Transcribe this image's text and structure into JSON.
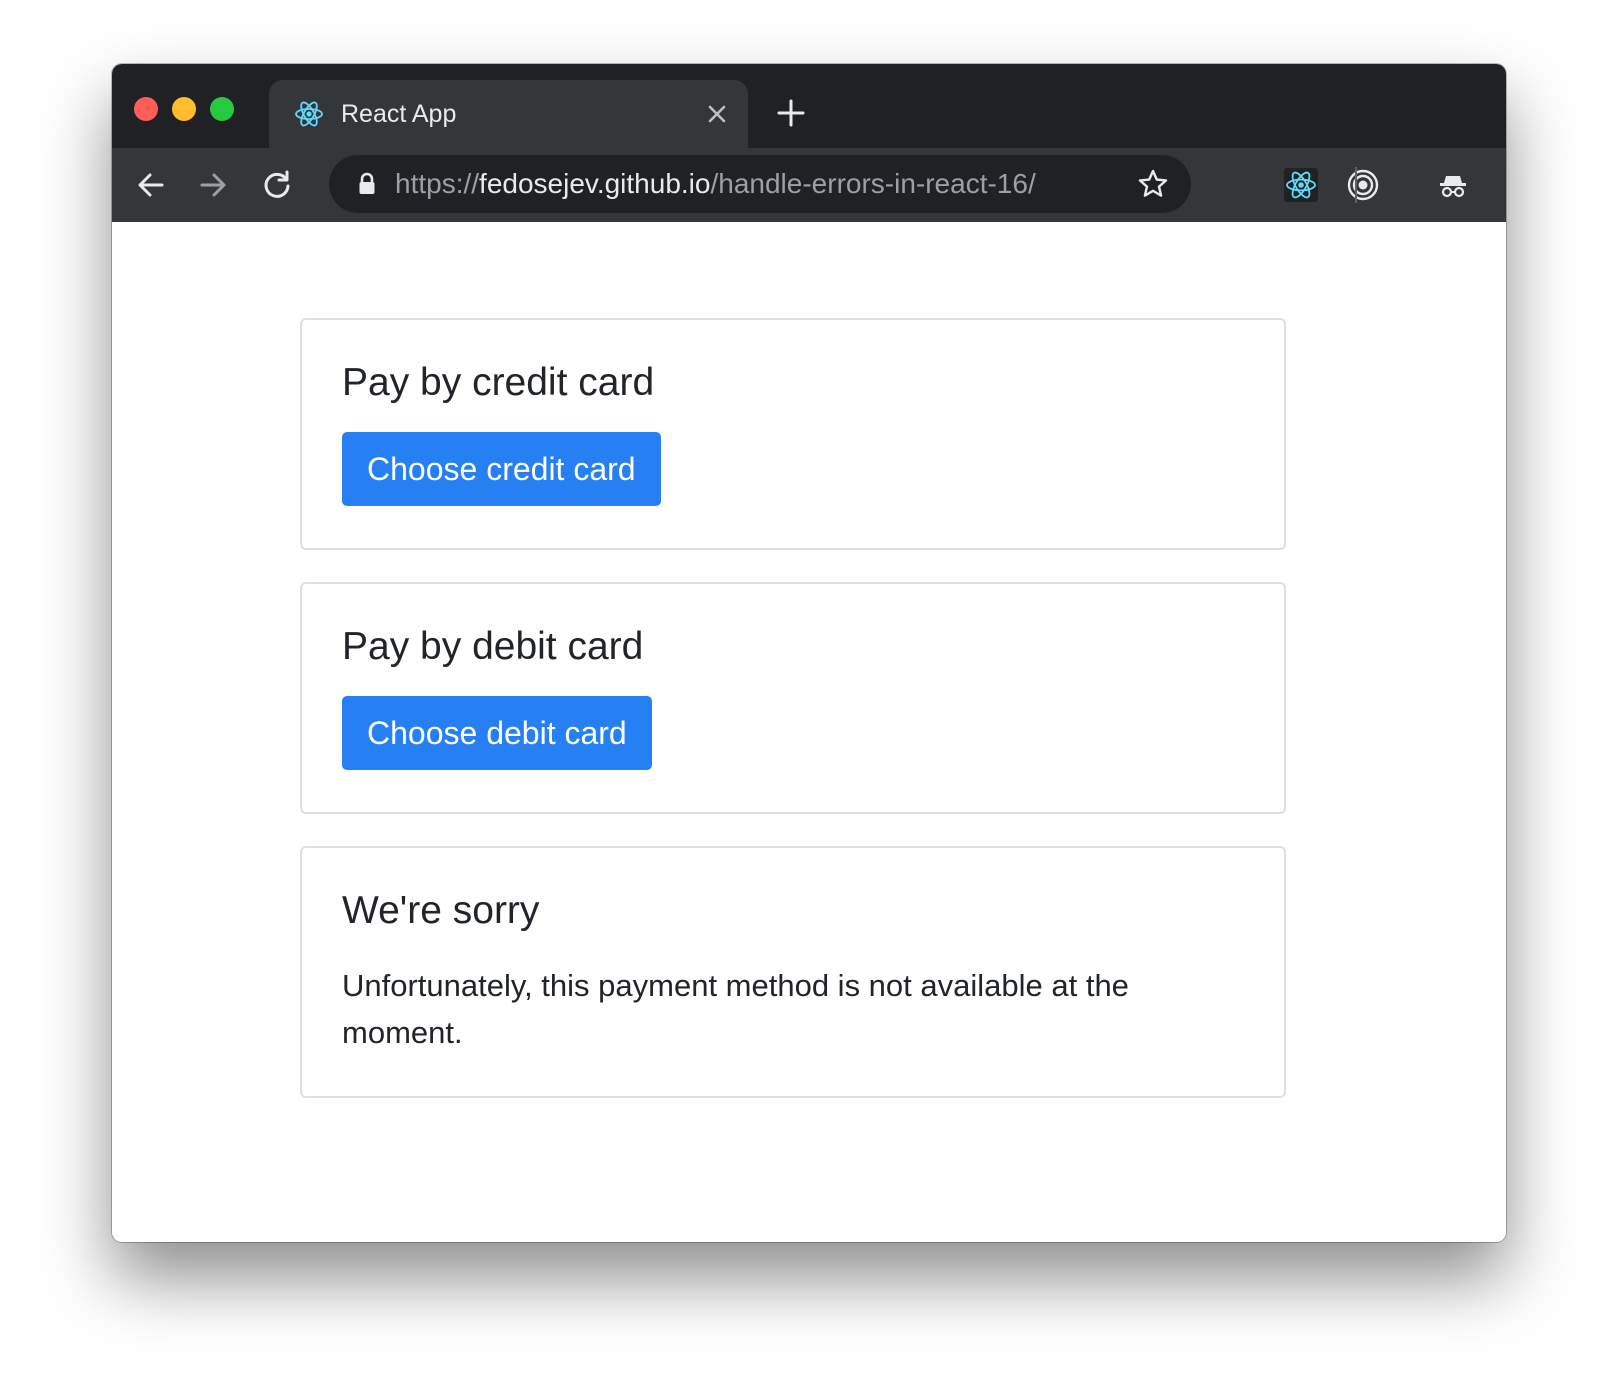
{
  "browser": {
    "tab": {
      "title": "React App",
      "favicon": "react-atom-icon"
    },
    "url": {
      "scheme": "https://",
      "host": "fedosejev.github.io",
      "path": "/handle-errors-in-react-16/"
    },
    "colors": {
      "titlebar": "#202124",
      "toolbar": "#35363a",
      "omnibox": "#202124",
      "close": "#ff5f57",
      "minimize": "#febc2e",
      "zoom": "#28c840",
      "react": "#61dafb"
    }
  },
  "cards": [
    {
      "heading": "Pay by credit card",
      "button_label": "Choose credit card"
    },
    {
      "heading": "Pay by debit card",
      "button_label": "Choose debit card"
    },
    {
      "heading": "We're sorry",
      "message": "Unfortunately, this payment method is not available at the moment."
    }
  ],
  "colors": {
    "primary_button": "#2680f3",
    "card_border": "#dfdfdf",
    "text": "#212529"
  }
}
